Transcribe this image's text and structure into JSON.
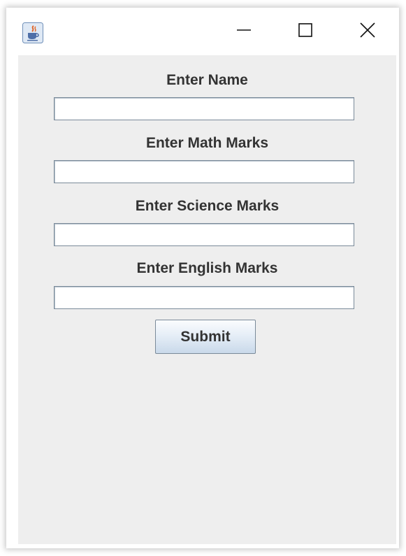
{
  "titlebar": {
    "app_icon": "java-coffee-cup-icon",
    "controls": {
      "minimize_icon": "minimize-icon",
      "maximize_icon": "maximize-icon",
      "close_icon": "close-icon"
    }
  },
  "form": {
    "fields": [
      {
        "label": "Enter Name",
        "value": ""
      },
      {
        "label": "Enter Math Marks",
        "value": ""
      },
      {
        "label": "Enter Science Marks",
        "value": ""
      },
      {
        "label": "Enter English Marks",
        "value": ""
      }
    ],
    "submit_label": "Submit"
  },
  "colors": {
    "content_background": "#eeeeee",
    "label_text": "#333333",
    "input_border": "#7a8a99",
    "button_gradient_top": "#fbfcfe",
    "button_gradient_bottom": "#c9d9ea"
  }
}
